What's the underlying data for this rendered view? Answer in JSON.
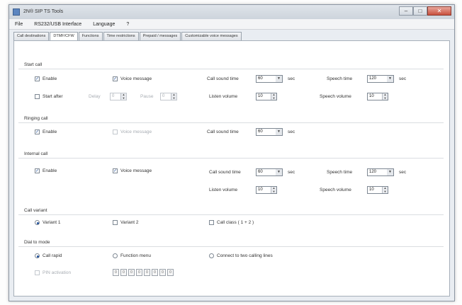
{
  "window": {
    "title": "2N® SIP TS Tools"
  },
  "menu": [
    {
      "label": "File"
    },
    {
      "label": "RS232/USB Interface"
    },
    {
      "label": "Language"
    },
    {
      "label": "?"
    }
  ],
  "tabs": [
    {
      "label": "Call destinations"
    },
    {
      "label": "DTMF/CFW"
    },
    {
      "label": "Functions"
    },
    {
      "label": "Time restrictions"
    },
    {
      "label": "Prepaid / messages"
    },
    {
      "label": "Customizable voice messages"
    }
  ],
  "active_tab": 1,
  "start_call": {
    "label": "Start call",
    "enable": "Enable",
    "voice_message": "Voice message",
    "start_after": "Start after",
    "delay_label": "Delay",
    "delay_value": "0",
    "pause_label": "Pause",
    "pause_value": "0",
    "call_sound_time_label": "Call sound time",
    "call_sound_time_value": "60",
    "sec": "sec",
    "speech_time_label": "Speech time",
    "speech_time_value": "120",
    "listen_volume_label": "Listen volume",
    "listen_volume_value": "10",
    "speech_volume_label": "Speech volume",
    "speech_volume_value": "10"
  },
  "ring_call": {
    "label": "Ringing call",
    "enable": "Enable",
    "voice_message": "Voice message",
    "call_sound_time_label": "Call sound time",
    "call_sound_time_value": "60",
    "sec": "sec"
  },
  "internal_call": {
    "label": "Internal call",
    "enable": "Enable",
    "voice_message": "Voice message",
    "call_sound_time_label": "Call sound time",
    "call_sound_time_value": "60",
    "sec": "sec",
    "speech_time_label": "Speech time",
    "speech_time_value": "120",
    "listen_volume_label": "Listen volume",
    "listen_volume_value": "10",
    "speech_volume_label": "Speech volume",
    "speech_volume_value": "10"
  },
  "call_variant": {
    "label": "Call variant",
    "options": [
      "Variant 1",
      "Variant 2",
      "Call class ( 1 + 2 )"
    ]
  },
  "dial_mode": {
    "label": "Dial to mode",
    "options": [
      "Call rapid",
      "Function menu",
      "Connect to two calling lines"
    ],
    "pin_label": "PIN activation",
    "keys": [
      "0",
      "0",
      "0",
      "0",
      "0",
      "0",
      "0",
      "0"
    ]
  }
}
